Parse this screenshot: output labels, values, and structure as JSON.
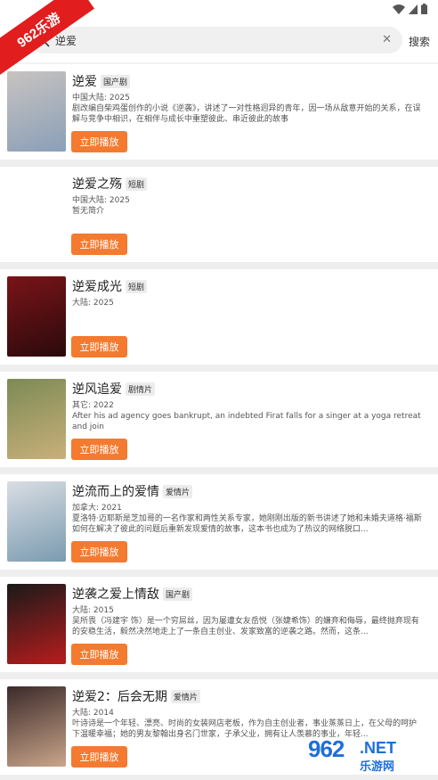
{
  "watermark": {
    "corner_label": "962乐游",
    "brand_logo": "962",
    "brand_net": ".NET",
    "brand_sub": "乐游网"
  },
  "search": {
    "query": "逆爱",
    "submit_label": "搜索"
  },
  "results": [
    {
      "title": "逆爱",
      "tag": "国产剧",
      "meta": "中国大陆: 2025",
      "desc": "剧改编自柴鸡蛋创作的小说《逆袭》，讲述了一对性格迥异的青年，因一场从敌意开始的关系，在误解与竞争中相识，在相伴与成长中重塑彼此、串近彼此的故事",
      "play_label": "立即播放",
      "poster_colors": [
        "#c8c3c0",
        "#8a9fb8"
      ]
    },
    {
      "title": "逆爱之殇",
      "tag": "短剧",
      "meta": "中国大陆: 2025",
      "desc": "暂无简介",
      "play_label": "立即播放",
      "poster_colors": null
    },
    {
      "title": "逆爱成光",
      "tag": "短剧",
      "meta": "大陆: 2025",
      "desc": "",
      "play_label": "立即播放",
      "poster_colors": [
        "#7a1418",
        "#2a0a0c"
      ]
    },
    {
      "title": "逆风追爱",
      "tag": "剧情片",
      "meta": "其它: 2022",
      "desc": "After his ad agency goes bankrupt, an indebted Firat falls for a singer at a yoga retreat and join",
      "play_label": "立即播放",
      "poster_colors": [
        "#7c8a55",
        "#c9b07a"
      ]
    },
    {
      "title": "逆流而上的爱情",
      "tag": "爱情片",
      "meta": "加拿大: 2021",
      "desc": "夏洛特·迈耶斯是芝加哥的一名作家和两性关系专家，她刚刚出版的新书讲述了她和未婚夫道格·福斯如何在解决了彼此的问题后重新发现爱情的故事，这本书也成为了热议的网络脱口...",
      "play_label": "立即播放",
      "poster_colors": [
        "#d9dde3",
        "#7a9bb0"
      ]
    },
    {
      "title": "逆袭之爱上情敌",
      "tag": "国产剧",
      "meta": "大陆: 2015",
      "desc": "吴所畏（冯建宇 饰）是一个穷屌丝，因为屡遭女友岳悦（张婕希饰）的嫌弃和侮辱，最终抛弃现有的安稳生活，毅然决然地走上了一条自主创业、发家致富的逆袭之路。然而，这条...",
      "play_label": "立即播放",
      "poster_colors": [
        "#1a1a1a",
        "#b81c1c"
      ]
    },
    {
      "title": "逆爱2：后会无期",
      "tag": "爱情片",
      "meta": "大陆: 2014",
      "desc": "叶诗诗是一个年轻、漂亮、时尚的女装网店老板，作为自主创业者，事业蒸蒸日上，在父母的呵护下温暖幸福；她的男友黎翰出身名门世家，子承父业，拥有让人羡慕的事业，年轻...",
      "play_label": "立即播放",
      "poster_colors": [
        "#3b2a2a",
        "#caa58a"
      ]
    }
  ]
}
